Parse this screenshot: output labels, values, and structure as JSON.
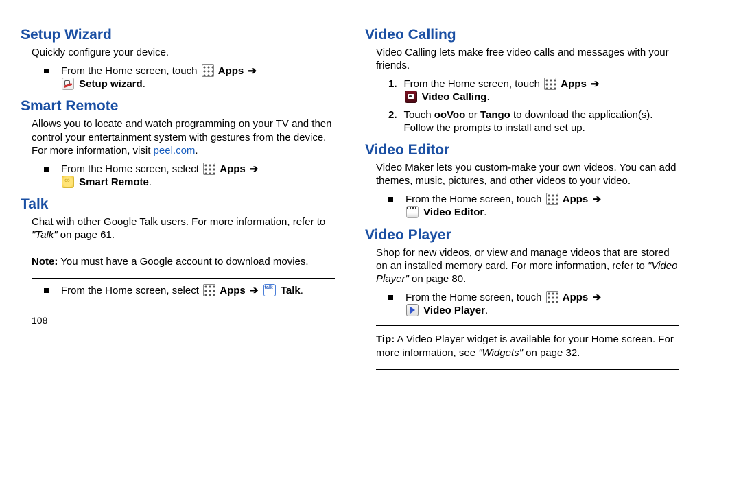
{
  "page_number": "108",
  "common": {
    "apps_label": "Apps",
    "arrow": "➔",
    "from_home_touch": "From the Home screen, touch",
    "from_home_select": "From the Home screen, select"
  },
  "setup_wizard": {
    "heading": "Setup Wizard",
    "intro": "Quickly configure your device.",
    "app_label": "Setup wizard"
  },
  "smart_remote": {
    "heading": "Smart Remote",
    "intro_pre": "Allows you to locate and watch programming on your TV and then control your entertainment system with gestures from the device. For more information, visit ",
    "link": "peel.com",
    "intro_post": ".",
    "app_label": "Smart Remote"
  },
  "talk": {
    "heading": "Talk",
    "intro_pre": "Chat with other Google Talk users. For more information, refer to ",
    "ref": "\"Talk\"",
    "intro_post": " on page 61.",
    "note_label": "Note:",
    "note_body": " You must have a Google account to download movies.",
    "app_label": "Talk"
  },
  "video_calling": {
    "heading": "Video Calling",
    "intro": "Video Calling lets make free video calls and messages with your friends.",
    "step1_num": "1.",
    "app_label": "Video Calling",
    "step2_num": "2.",
    "step2_a": "Touch ",
    "step2_b": "ooVoo",
    "step2_c": " or ",
    "step2_d": "Tango",
    "step2_e": " to download the application(s). Follow the prompts to install and set up."
  },
  "video_editor": {
    "heading": "Video Editor",
    "intro": "Video Maker lets you custom-make your own videos. You can add themes, music, pictures, and other videos to your video.",
    "app_label": "Video Editor"
  },
  "video_player": {
    "heading": "Video Player",
    "intro_pre": "Shop for new videos, or view and manage videos that are stored on an installed memory card. For more information, refer to ",
    "ref": "\"Video Player\"",
    "intro_post": " on page 80.",
    "app_label": "Video Player",
    "tip_label": "Tip:",
    "tip_a": " A Video Player widget is available for your Home screen. For more information, see ",
    "tip_ref": "\"Widgets\"",
    "tip_b": " on page 32."
  }
}
